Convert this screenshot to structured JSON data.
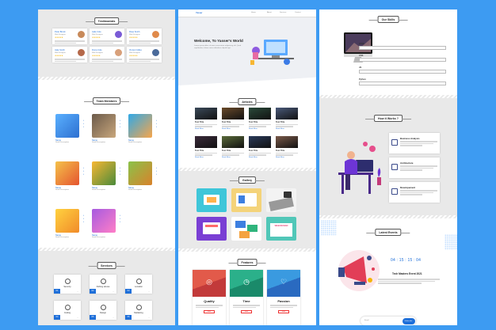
{
  "panel1": {
    "testimonials": {
      "title": "Testimonials",
      "items": [
        {
          "name": "Peter Brock",
          "role": "Web Designer",
          "stars": "★★★★★"
        },
        {
          "name": "Jade Cole",
          "role": "Web Designer",
          "stars": "★★★★★"
        },
        {
          "name": "Rose Smith",
          "role": "Web Designer",
          "stars": "★★★★★"
        },
        {
          "name": "Jake Smith",
          "role": "Web Designer",
          "stars": "★★★★★"
        },
        {
          "name": "Fiona Cole",
          "role": "Web Designer",
          "stars": "★★★★★"
        },
        {
          "name": "Vincent Gilles",
          "role": "Web Designer",
          "stars": "★★★★★"
        }
      ]
    },
    "team": {
      "title": "Team Members",
      "members": [
        {
          "name": "Name",
          "role": "Small Description"
        },
        {
          "name": "Name",
          "role": "Small Description"
        },
        {
          "name": "Name",
          "role": "Small Description"
        },
        {
          "name": "Name",
          "role": "Small Description"
        },
        {
          "name": "Name",
          "role": "Small Description"
        },
        {
          "name": "Name",
          "role": "Small Description"
        },
        {
          "name": "Name",
          "role": "Small Description"
        },
        {
          "name": "Name",
          "role": "Small Description"
        }
      ]
    },
    "services": {
      "title": "Services",
      "items": [
        {
          "num": "01",
          "label": "Security"
        },
        {
          "num": "02",
          "label": "Fishing House"
        },
        {
          "num": "03",
          "label": "Location"
        },
        {
          "num": "04",
          "label": "Coding"
        },
        {
          "num": "05",
          "label": "Design"
        },
        {
          "num": "06",
          "label": "Marketing"
        }
      ]
    }
  },
  "panel2": {
    "nav": {
      "brand": "Yasser",
      "links": [
        "Home",
        "About",
        "Services",
        "Contact"
      ]
    },
    "hero": {
      "title": "Welcome, To Yasser's World",
      "body": "Lorem ipsum dolor sit amet consectetur adipisicing elit. Quod repellendus, labore natus doloribus aliquid fugit."
    },
    "articles": {
      "title": "Articles",
      "items": [
        {
          "title": "Test Title",
          "more": "Read More"
        },
        {
          "title": "Test Title",
          "more": "Read More"
        },
        {
          "title": "Test Title",
          "more": "Read More"
        },
        {
          "title": "Test Title",
          "more": "Read More"
        },
        {
          "title": "Test Title",
          "more": "Read More"
        },
        {
          "title": "Test Title",
          "more": "Read More"
        },
        {
          "title": "Test Title",
          "more": "Read More"
        },
        {
          "title": "Test Title",
          "more": "Read More"
        }
      ]
    },
    "gallery": {
      "title": "Gallery",
      "web_design_label": "WEB DESIGN"
    },
    "features": {
      "title": "Features",
      "items": [
        {
          "title": "Quality",
          "button": "More"
        },
        {
          "title": "Time",
          "button": "More"
        },
        {
          "title": "Passion",
          "button": "More"
        }
      ]
    }
  },
  "panel3": {
    "skills": {
      "title": "Our Skills",
      "items": [
        {
          "label": "HTML",
          "value": 80
        },
        {
          "label": "CSS",
          "value": 85
        },
        {
          "label": "JS",
          "value": 70
        },
        {
          "label": "Python",
          "value": 80
        }
      ]
    },
    "how": {
      "title": "How it Works ?",
      "steps": [
        {
          "title": "Business Analysis"
        },
        {
          "title": "Architecture"
        },
        {
          "title": "Developement"
        }
      ]
    },
    "events": {
      "title": "Latest Events",
      "countdown": "04 : 15 : 15 : 04",
      "event_title": "Tech Masters Event 2021",
      "subscribe_placeholder": "Email",
      "subscribe_button": "Subscribe"
    }
  },
  "colors": {
    "background": "#3d9bf2",
    "accent": "#1e6fd9",
    "section_gray": "#e9e9e9",
    "star": "#f6b400",
    "button_red": "#e33"
  }
}
